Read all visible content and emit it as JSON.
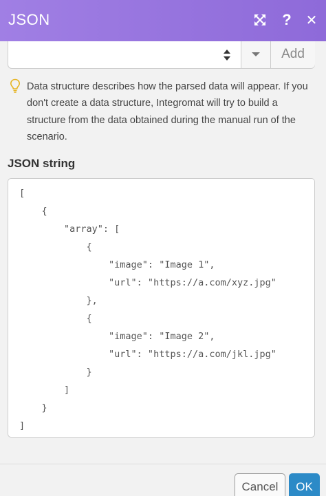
{
  "header": {
    "title": "JSON",
    "background_color": "#9a78e0",
    "icons": [
      "expand-icon",
      "help-icon",
      "close-icon"
    ],
    "help_glyph": "?",
    "close_glyph": "✕"
  },
  "data_structure": {
    "selected_value": "",
    "add_label": "Add"
  },
  "hint": {
    "icon": "lightbulb-icon",
    "text": "Data structure describes how the parsed data will appear. If you don't create a data structure, Integromat will try to build a structure from the data obtained during the manual run of the scenario."
  },
  "json_field": {
    "label": "JSON string",
    "lines": [
      "[",
      "    {",
      "        \"array\": [",
      "            {",
      "                \"image\": \"Image 1\",",
      "                \"url\": \"https://a.com/xyz.jpg\"",
      "            },",
      "            {",
      "                \"image\": \"Image 2\",",
      "                \"url\": \"https://a.com/jkl.jpg\"",
      "            }",
      "        ]",
      "    }",
      "]"
    ]
  },
  "footer": {
    "cancel_label": "Cancel",
    "ok_label": "OK",
    "ok_color": "#2c8ac7"
  }
}
